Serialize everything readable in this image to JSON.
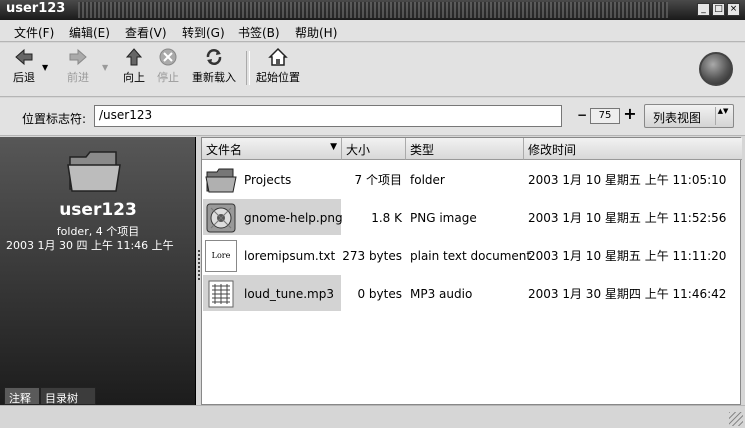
{
  "window": {
    "title": "user123",
    "minimize_glyph": "_",
    "maximize_glyph": "□",
    "close_glyph": "×"
  },
  "menubar": {
    "items": [
      "文件(F)",
      "编辑(E)",
      "查看(V)",
      "转到(G)",
      "书签(B)",
      "帮助(H)"
    ]
  },
  "toolbar": {
    "back": "后退",
    "forward": "前进",
    "up": "向上",
    "stop": "停止",
    "reload": "重新载入",
    "home": "起始位置",
    "dropdown_arrow": "▼"
  },
  "location": {
    "label": "位置标志符:",
    "value": "/user123",
    "zoom": "75",
    "zoom_out": "−",
    "zoom_in": "+",
    "view_mode": "列表视图",
    "view_arrows": "▲▼"
  },
  "sidebar": {
    "name": "user123",
    "info": "folder, 4 个项目",
    "date": "2003  1月 30 四 上午 11:46 上午",
    "tabs": [
      "注释",
      "目录树"
    ]
  },
  "columns": {
    "name": "文件名",
    "size": "大小",
    "type": "类型",
    "modified": "修改时间",
    "sort_arrow": "▼"
  },
  "files": [
    {
      "name": "Projects",
      "size": "7 个项目",
      "type": "folder",
      "modified": "2003  1月 10 星期五 上午 11:05:10",
      "icon": "folder-icon"
    },
    {
      "name": "gnome-help.png",
      "size": "1.8 K",
      "type": "PNG image",
      "modified": "2003  1月 10 星期五 上午 11:52:56",
      "icon": "image-icon"
    },
    {
      "name": "loremipsum.txt",
      "size": "273 bytes",
      "type": "plain text document",
      "modified": "2003  1月 10 星期五 上午 11:11:20",
      "icon": "text-file-icon",
      "preview": "Lore"
    },
    {
      "name": "loud_tune.mp3",
      "size": "0 bytes",
      "type": "MP3 audio",
      "modified": "2003  1月 30 星期四 上午 11:46:42",
      "icon": "audio-file-icon"
    }
  ],
  "colors": {
    "highlight": "#d3d3d3",
    "sidebar_top": "#575757",
    "sidebar_bottom": "#1c1c1c",
    "titlebar": "#2a2a2a"
  }
}
